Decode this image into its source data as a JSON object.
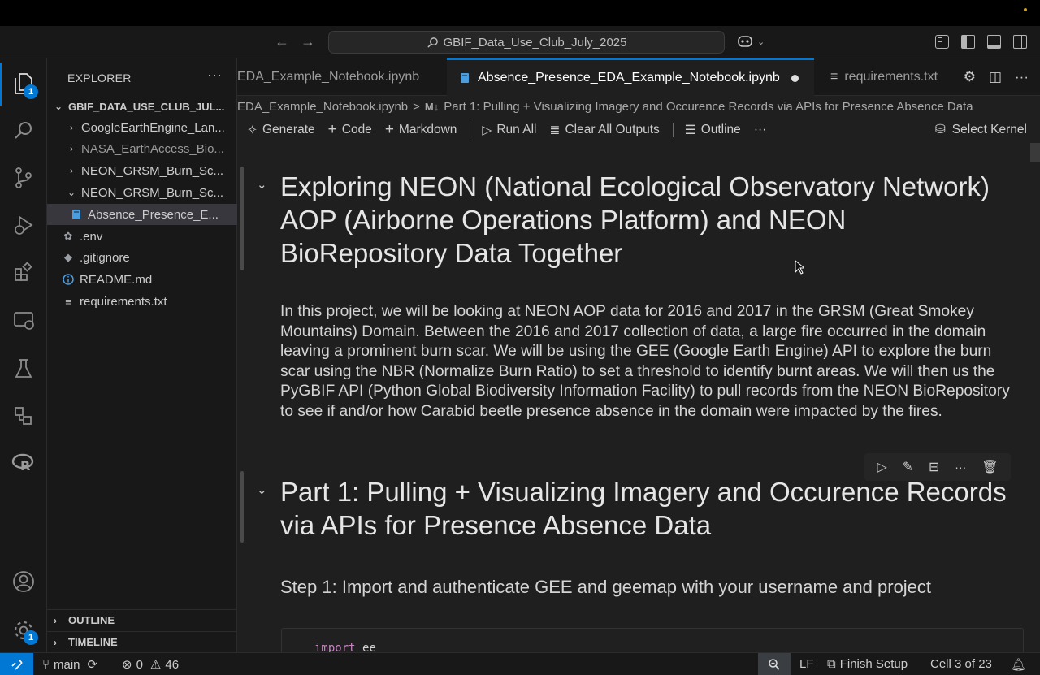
{
  "window": {
    "command_center": "GBIF_Data_Use_Club_July_2025"
  },
  "activity_bar": {
    "explorer_badge": "1",
    "accounts_badge": "1"
  },
  "sidebar": {
    "title": "EXPLORER",
    "workspace": "GBIF_DATA_USE_CLUB_JUL...",
    "items": [
      {
        "label": "GoogleEarthEngine_Lan...",
        "type": "folder"
      },
      {
        "label": "NASA_EarthAccess_Bio...",
        "type": "folder"
      },
      {
        "label": "NEON_GRSM_Burn_Sc...",
        "type": "folder"
      },
      {
        "label": "NEON_GRSM_Burn_Sc...",
        "type": "folder-open"
      },
      {
        "label": "Absence_Presence_E...",
        "type": "notebook"
      },
      {
        "label": ".env",
        "type": "settings"
      },
      {
        "label": ".gitignore",
        "type": "git"
      },
      {
        "label": "README.md",
        "type": "info"
      },
      {
        "label": "requirements.txt",
        "type": "text"
      }
    ],
    "outline_label": "OUTLINE",
    "timeline_label": "TIMELINE"
  },
  "tabs": [
    {
      "label": "EDA_Example_Notebook.ipynb"
    },
    {
      "label": "Absence_Presence_EDA_Example_Notebook.ipynb"
    },
    {
      "label": "requirements.txt"
    }
  ],
  "breadcrumb": {
    "file": "EDA_Example_Notebook.ipynb",
    "separator": ">",
    "md_marker": "M↓",
    "section": "Part 1: Pulling + Visualizing Imagery and Occurence Records via APIs for Presence Absence Data"
  },
  "toolbar": {
    "generate": "Generate",
    "code": "Code",
    "markdown": "Markdown",
    "run_all": "Run All",
    "clear_outputs": "Clear All Outputs",
    "outline": "Outline",
    "more": "···",
    "select_kernel": "Select Kernel"
  },
  "notebook": {
    "heading1": "Exploring NEON (National Ecological Observatory Network) AOP (Airborne Operations Platform) and NEON BioRepository Data Together",
    "intro": "In this project, we will be looking at NEON AOP data for 2016 and 2017 in the GRSM (Great Smokey Mountains) Domain. Between the 2016 and 2017 collection of data, a large fire occurred in the domain leaving a prominent burn scar. We will be using the GEE (Google Earth Engine) API to explore the burn scar using the NBR (Normalize Burn Ratio) to set a threshold to identify burnt areas. We will then us the PyGBIF API (Python Global Biodiversity Information Facility) to pull records from the NEON BioRepository to see if and/or how Carabid beetle presence absence in the domain were impacted by the fires.",
    "heading2": "Part 1: Pulling + Visualizing Imagery and Occurence Records via APIs for Presence Absence Data",
    "step1": "Step 1: Import and authenticate GEE and geemap with your username and project",
    "code_keyword": "import",
    "code_rest": "ee"
  },
  "statusbar": {
    "branch": "main",
    "errors": "0",
    "warnings": "46",
    "eol": "LF",
    "finish_setup": "Finish Setup",
    "cell_position": "Cell 3 of 23"
  },
  "colors": {
    "accent": "#0078d4",
    "editor_bg": "#1f1f1f",
    "chrome_bg": "#181818"
  }
}
